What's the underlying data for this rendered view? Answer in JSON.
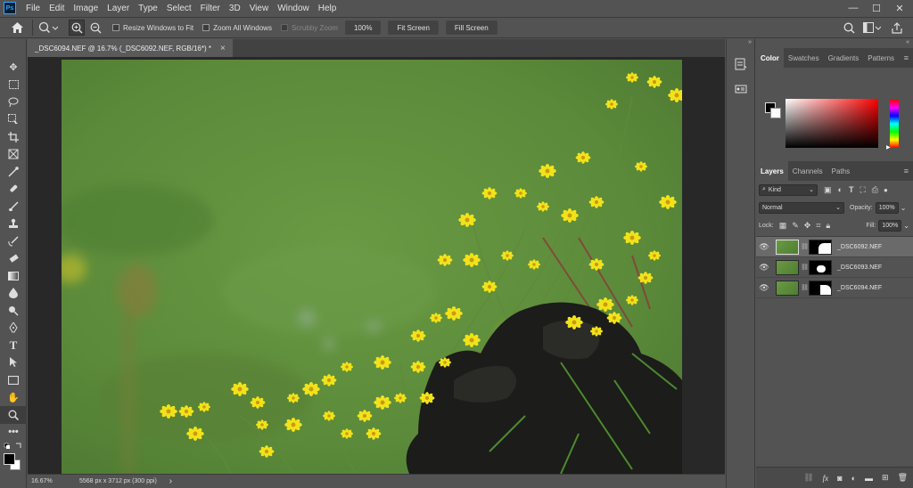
{
  "app": {
    "logo": "Ps"
  },
  "menu": [
    "File",
    "Edit",
    "Image",
    "Layer",
    "Type",
    "Select",
    "Filter",
    "3D",
    "View",
    "Window",
    "Help"
  ],
  "window_controls": {
    "minimize": "—",
    "maximize": "☐",
    "close": "✕"
  },
  "options_bar": {
    "resize_windows_label": "Resize Windows to Fit",
    "zoom_all_label": "Zoom All Windows",
    "scrubby_zoom_label": "Scrubby Zoom",
    "zoom_value": "100%",
    "fit_screen_label": "Fit Screen",
    "fill_screen_label": "Fill Screen"
  },
  "document": {
    "tab_title": "_DSC6094.NEF @ 16.7% (_DSC6092.NEF, RGB/16*) *",
    "close": "×"
  },
  "status": {
    "zoom": "16.67%",
    "dimensions": "5568 px x 3712 px (300 ppi)",
    "arrow": "›"
  },
  "color_panel": {
    "tabs": [
      "Color",
      "Swatches",
      "Gradients",
      "Patterns"
    ],
    "foreground": "#000000",
    "background": "#ffffff"
  },
  "layers_panel": {
    "tabs": [
      "Layers",
      "Channels",
      "Paths"
    ],
    "filter_kind": "Kind",
    "blend_mode": "Normal",
    "opacity_label": "Opacity:",
    "opacity_value": "100%",
    "lock_label": "Lock:",
    "fill_label": "Fill:",
    "fill_value": "100%",
    "layers": [
      {
        "name": "_DSC6092.NEF",
        "selected": true
      },
      {
        "name": "_DSC6093.NEF",
        "selected": false
      },
      {
        "name": "_DSC6094.NEF",
        "selected": false
      }
    ]
  },
  "colors": {
    "ui_bg": "#535353",
    "panel_dark": "#424242",
    "canvas_bg": "#282828",
    "flower_yellow": "#f2e21a",
    "grass_green": "#5f8f3a"
  }
}
